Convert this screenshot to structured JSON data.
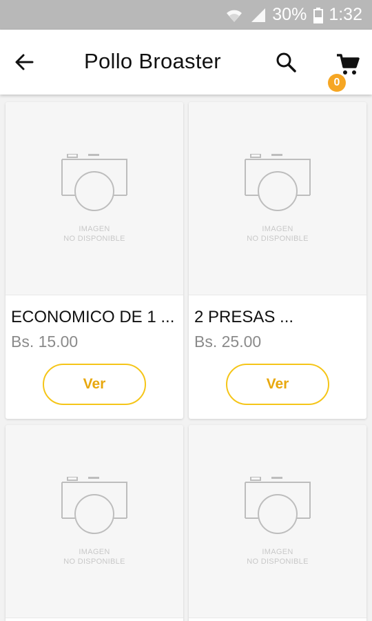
{
  "status_bar": {
    "battery_text": "30%",
    "time": "1:32",
    "icons": [
      "wifi-icon",
      "signal-icon",
      "battery-icon"
    ]
  },
  "app_bar": {
    "title": "Pollo Broaster",
    "cart_count": "0",
    "icons": [
      "back-arrow-icon",
      "search-icon",
      "cart-icon"
    ]
  },
  "placeholder": {
    "line1": "IMAGEN",
    "line2": "NO DISPONIBLE"
  },
  "products": [
    {
      "name": "ECONOMICO DE 1 ...",
      "price": "Bs. 15.00",
      "button": "Ver"
    },
    {
      "name": "2 PRESAS ...",
      "price": "Bs. 25.00",
      "button": "Ver"
    },
    {
      "name": "",
      "price": "",
      "button": ""
    },
    {
      "name": "",
      "price": "",
      "button": ""
    }
  ],
  "colors": {
    "accent": "#f5c518",
    "badge": "#f6a623",
    "status_bar": "#b8b8b8"
  }
}
